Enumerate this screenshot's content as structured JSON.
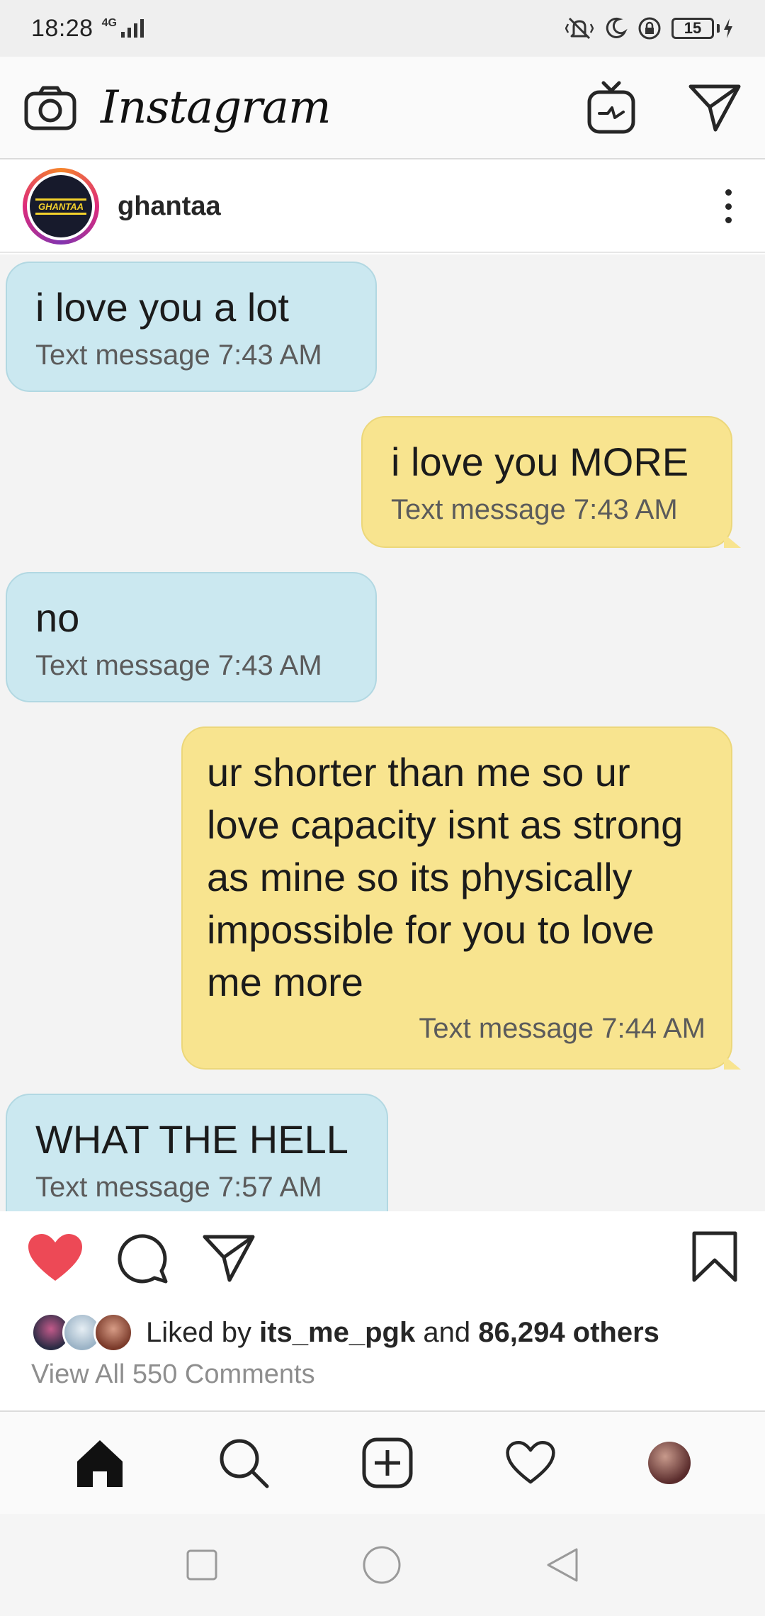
{
  "status_bar": {
    "time": "18:28",
    "network": "4G",
    "battery": "15"
  },
  "header": {
    "brand": "Instagram",
    "icons": [
      "camera-icon",
      "igtv-icon",
      "direct-message-icon"
    ]
  },
  "post": {
    "username": "ghantaa",
    "avatar_text": "GHANTAA",
    "messages": [
      {
        "side": "left",
        "text": "i love you a lot",
        "meta": "Text message 7:43 AM"
      },
      {
        "side": "right",
        "text": "i love you MORE",
        "meta": "Text message 7:43 AM"
      },
      {
        "side": "left",
        "text": "no",
        "meta": "Text message 7:43 AM"
      },
      {
        "side": "right",
        "text": "ur shorter than me so ur love capacity isnt as strong as mine so its physically impossible for you to love me more",
        "meta": "Text message 7:44 AM"
      },
      {
        "side": "left",
        "text": "WHAT THE HELL",
        "meta": "Text message 7:57 AM"
      }
    ],
    "liked": true,
    "likes": {
      "prefix": "Liked by",
      "user": "its_me_pgk",
      "middle": "and",
      "others": "86,294 others"
    },
    "view_comments": "View All 550 Comments"
  },
  "colors": {
    "heart": "#ed4956",
    "bubble_left": "#cbe8f0",
    "bubble_right": "#f8e48f"
  },
  "bottom_nav": {
    "items": [
      "home-icon",
      "search-icon",
      "add-post-icon",
      "activity-heart-icon",
      "profile-avatar"
    ]
  },
  "system_nav": {
    "items": [
      "recents-square-icon",
      "home-circle-icon",
      "back-triangle-icon"
    ]
  }
}
